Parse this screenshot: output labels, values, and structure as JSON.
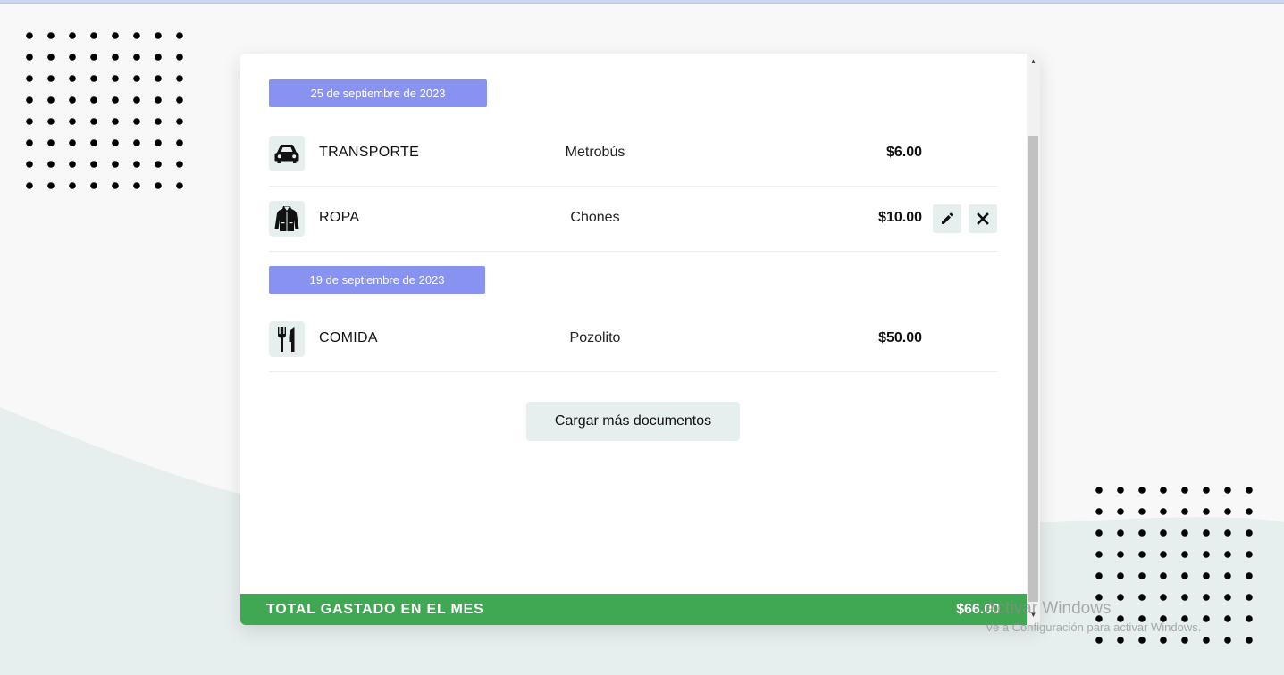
{
  "groups": [
    {
      "date": "25 de septiembre de 2023",
      "items": [
        {
          "category": "TRANSPORTE",
          "description": "Metrobús",
          "amount": "$6.00",
          "icon": "car-icon"
        },
        {
          "category": "ROPA",
          "description": "Chones",
          "amount": "$10.00",
          "icon": "jacket-icon"
        }
      ]
    },
    {
      "date": "19 de septiembre de 2023",
      "items": [
        {
          "category": "COMIDA",
          "description": "Pozolito",
          "amount": "$50.00",
          "icon": "fork-knife-icon"
        }
      ]
    }
  ],
  "load_more_label": "Cargar más documentos",
  "total": {
    "label": "TOTAL GASTADO EN EL MES",
    "value": "$66.00"
  },
  "row_actions": {
    "edit_icon": "pencil-icon",
    "delete_icon": "close-icon"
  },
  "windows_watermark": {
    "line1": "Activar Windows",
    "line2": "Ve a Configuración para activar Windows."
  },
  "colors": {
    "date_pill": "#8892f0",
    "total_bar": "#40a853",
    "icon_bg": "#e7eeee",
    "page_bg": "#f8f8f8",
    "wave": "#e7eeee"
  }
}
